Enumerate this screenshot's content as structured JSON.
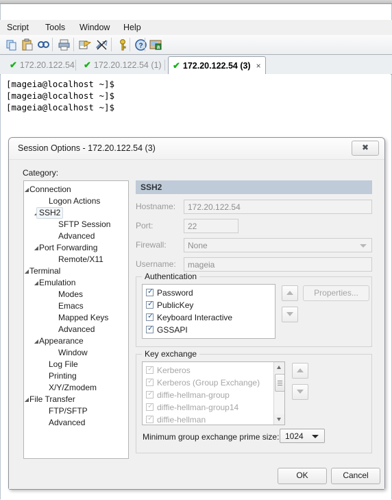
{
  "app": {
    "menu": [
      {
        "label": "Script"
      },
      {
        "label": "Tools"
      },
      {
        "label": "Window"
      },
      {
        "label": "Help"
      }
    ],
    "toolbar_icons": [
      "copy-icon",
      "paste-icon",
      "find-icon",
      "print-icon",
      "session-options-icon",
      "disconnect-icon",
      "key-icon",
      "help-icon",
      "screen-capture-icon"
    ],
    "tabs": [
      {
        "label": "172.20.122.54",
        "active": false,
        "status": "connected"
      },
      {
        "label": "172.20.122.54 (1)",
        "active": false,
        "status": "connected"
      },
      {
        "label": "172.20.122.54 (3)",
        "active": true,
        "status": "connected"
      }
    ],
    "tab_close_label": "×",
    "terminal_lines": [
      "[mageia@localhost ~]$",
      "[mageia@localhost ~]$",
      "[mageia@localhost ~]$"
    ]
  },
  "dialog": {
    "title": "Session Options - 172.20.122.54 (3)",
    "close_glyph": "✖",
    "category_label": "Category:",
    "tree": [
      {
        "label": "Connection",
        "depth": 0,
        "expander": true,
        "selected": false
      },
      {
        "label": "Logon Actions",
        "depth": 2,
        "expander": false,
        "selected": false
      },
      {
        "label": "SSH2",
        "depth": 1,
        "expander": true,
        "selected": true
      },
      {
        "label": "SFTP Session",
        "depth": 3,
        "expander": false,
        "selected": false
      },
      {
        "label": "Advanced",
        "depth": 3,
        "expander": false,
        "selected": false
      },
      {
        "label": "Port Forwarding",
        "depth": 1,
        "expander": true,
        "selected": false
      },
      {
        "label": "Remote/X11",
        "depth": 3,
        "expander": false,
        "selected": false
      },
      {
        "label": "Terminal",
        "depth": 0,
        "expander": true,
        "selected": false
      },
      {
        "label": "Emulation",
        "depth": 1,
        "expander": true,
        "selected": false
      },
      {
        "label": "Modes",
        "depth": 3,
        "expander": false,
        "selected": false
      },
      {
        "label": "Emacs",
        "depth": 3,
        "expander": false,
        "selected": false
      },
      {
        "label": "Mapped Keys",
        "depth": 3,
        "expander": false,
        "selected": false
      },
      {
        "label": "Advanced",
        "depth": 3,
        "expander": false,
        "selected": false
      },
      {
        "label": "Appearance",
        "depth": 1,
        "expander": true,
        "selected": false
      },
      {
        "label": "Window",
        "depth": 3,
        "expander": false,
        "selected": false
      },
      {
        "label": "Log File",
        "depth": 2,
        "expander": false,
        "selected": false
      },
      {
        "label": "Printing",
        "depth": 2,
        "expander": false,
        "selected": false
      },
      {
        "label": "X/Y/Zmodem",
        "depth": 2,
        "expander": false,
        "selected": false
      },
      {
        "label": "File Transfer",
        "depth": 0,
        "expander": true,
        "selected": false
      },
      {
        "label": "FTP/SFTP",
        "depth": 2,
        "expander": false,
        "selected": false
      },
      {
        "label": "Advanced",
        "depth": 2,
        "expander": false,
        "selected": false
      }
    ],
    "pane": {
      "header": "SSH2",
      "fields": [
        {
          "label": "Hostname:",
          "value": "172.20.122.54",
          "type": "text"
        },
        {
          "label": "Port:",
          "value": "22",
          "type": "text"
        },
        {
          "label": "Firewall:",
          "value": "None",
          "type": "select"
        },
        {
          "label": "Username:",
          "value": "mageia",
          "type": "text"
        }
      ],
      "authentication": {
        "caption": "Authentication",
        "items": [
          {
            "label": "Password",
            "checked": true,
            "disabled": false
          },
          {
            "label": "PublicKey",
            "checked": true,
            "disabled": false
          },
          {
            "label": "Keyboard Interactive",
            "checked": true,
            "disabled": false
          },
          {
            "label": "GSSAPI",
            "checked": true,
            "disabled": false
          }
        ],
        "properties_button": "Properties...",
        "up_button": "move-up",
        "down_button": "move-down"
      },
      "key_exchange": {
        "caption": "Key exchange",
        "items": [
          {
            "label": "Kerberos",
            "checked": true,
            "disabled": true
          },
          {
            "label": "Kerberos (Group Exchange)",
            "checked": true,
            "disabled": true
          },
          {
            "label": "diffie-hellman-group",
            "checked": true,
            "disabled": true
          },
          {
            "label": "diffie-hellman-group14",
            "checked": true,
            "disabled": true
          },
          {
            "label": "diffie-hellman",
            "checked": true,
            "disabled": true
          }
        ],
        "min_prime_label": "Minimum group exchange prime size:",
        "min_prime_value": "1024"
      }
    },
    "ok_label": "OK",
    "cancel_label": "Cancel"
  },
  "colors": {
    "tab_check_green": "#17b317",
    "pane_header_bg": "#bfcbd8",
    "dialog_bg": "#f0f0f0",
    "checkbox_blue": "#2c5d9b"
  }
}
